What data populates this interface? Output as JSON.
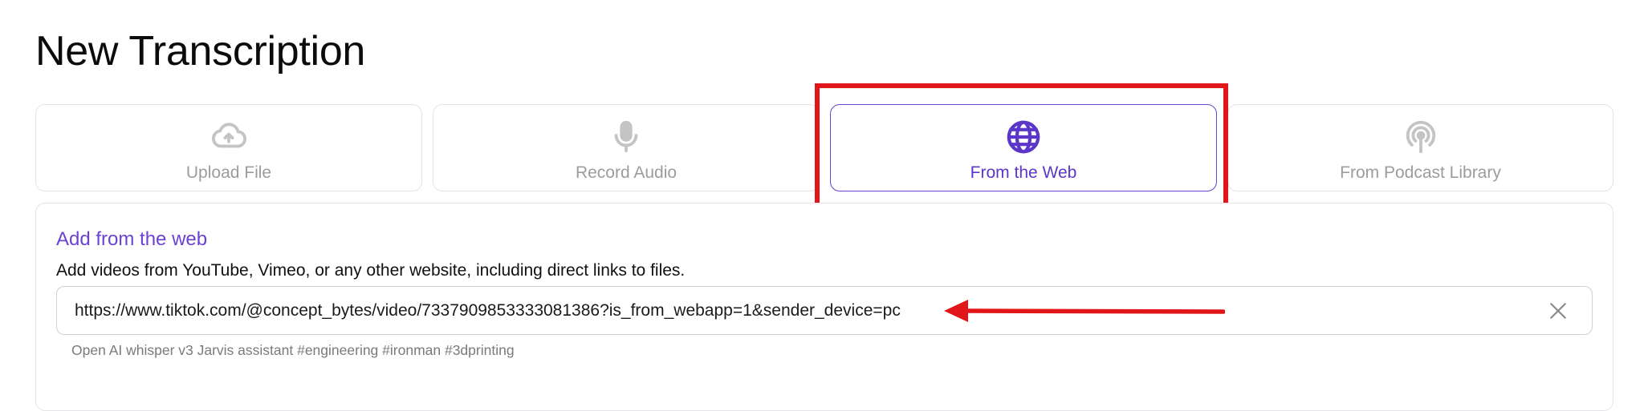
{
  "page": {
    "title": "New Transcription"
  },
  "tabs": [
    {
      "id": "upload",
      "label": "Upload File",
      "icon": "cloud-upload-icon",
      "active": false
    },
    {
      "id": "record",
      "label": "Record Audio",
      "icon": "microphone-icon",
      "active": false
    },
    {
      "id": "web",
      "label": "From the Web",
      "icon": "globe-icon",
      "active": true
    },
    {
      "id": "podcast",
      "label": "From Podcast Library",
      "icon": "podcast-icon",
      "active": false
    }
  ],
  "web_panel": {
    "title": "Add from the web",
    "description": "Add videos from YouTube, Vimeo, or any other website, including direct links to files.",
    "url_value": "https://www.tiktok.com/@concept_bytes/video/7337909853333081386?is_from_webapp=1&sender_device=pc",
    "hint": "Open AI whisper v3 Jarvis assistant #engineering #ironman #3dprinting"
  },
  "colors": {
    "accent": "#6a42d4",
    "inactive_text": "#9c9c9c",
    "border": "#e4e4e7",
    "annotation_red": "#e0161b"
  }
}
